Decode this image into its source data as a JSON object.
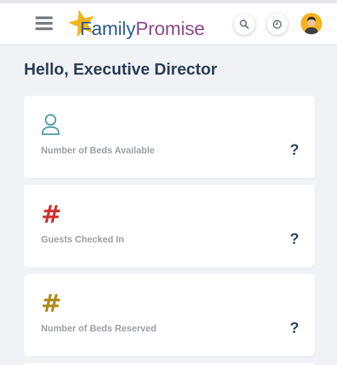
{
  "header": {
    "logo": {
      "family": "Family",
      "promise": "Promise"
    },
    "menu_icon": "hamburger-menu-icon",
    "search_icon": "search-icon",
    "history_icon": "clock-icon",
    "avatar_icon": "user-avatar"
  },
  "greeting": "Hello, Executive Director",
  "cards": [
    {
      "icon": "person-outline-icon",
      "icon_color": "#4b9aa8",
      "label": "Number of Beds Available",
      "help": "?"
    },
    {
      "icon": "hash-icon",
      "icon_color": "#cf3030",
      "label": "Guests Checked In",
      "help": "?"
    },
    {
      "icon": "hash-icon",
      "icon_color": "#ad8a1c",
      "label": "Number of Beds Reserved",
      "help": "?"
    }
  ],
  "colors": {
    "logo_family": "#2a5d94",
    "logo_promise": "#8e4a8e",
    "logo_star": "#f3b51b",
    "greeting": "#2c3e57",
    "help": "#2f4766",
    "label": "#9c9fa4",
    "background": "#f0f2f5"
  }
}
